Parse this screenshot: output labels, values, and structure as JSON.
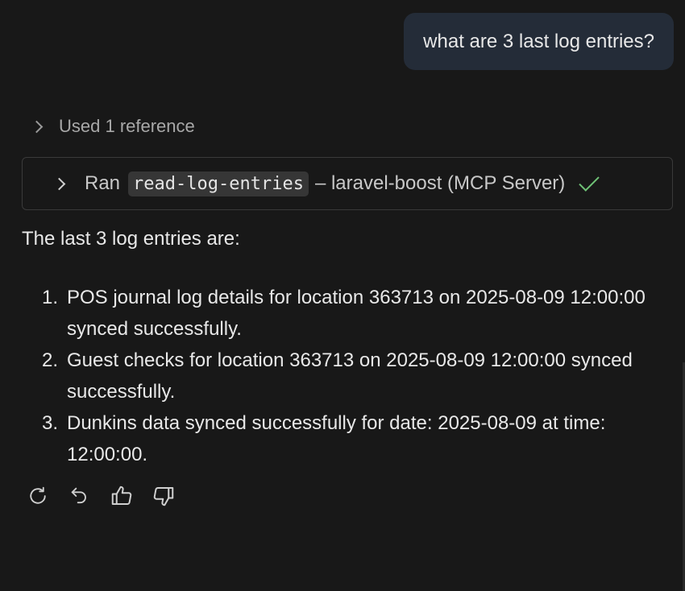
{
  "user_message": {
    "text": "what are 3 last log entries?"
  },
  "references": {
    "label": "Used 1 reference"
  },
  "tool_call": {
    "prefix": "Ran",
    "tool_name": "read-log-entries",
    "server": "– laravel-boost (MCP Server)",
    "status_icon": "check-icon",
    "status_color": "#6fc276"
  },
  "response": {
    "intro": "The last 3 log entries are:",
    "entries": [
      {
        "number": "1.",
        "text": "POS journal log details for location 363713 on 2025-08-09 12:00:00 synced successfully."
      },
      {
        "number": "2.",
        "text": "Guest checks for location 363713 on 2025-08-09 12:00:00 synced successfully."
      },
      {
        "number": "3.",
        "text": "Dunkins data synced successfully for date: 2025-08-09 at time: 12:00:00."
      }
    ]
  },
  "actions": [
    {
      "icon": "retry-icon"
    },
    {
      "icon": "undo-icon"
    },
    {
      "icon": "thumbs-up-icon"
    },
    {
      "icon": "thumbs-down-icon"
    }
  ],
  "colors": {
    "background": "#181818",
    "user_bubble": "#242c38",
    "tool_border": "#3a3a3a",
    "code_background": "#363636"
  }
}
